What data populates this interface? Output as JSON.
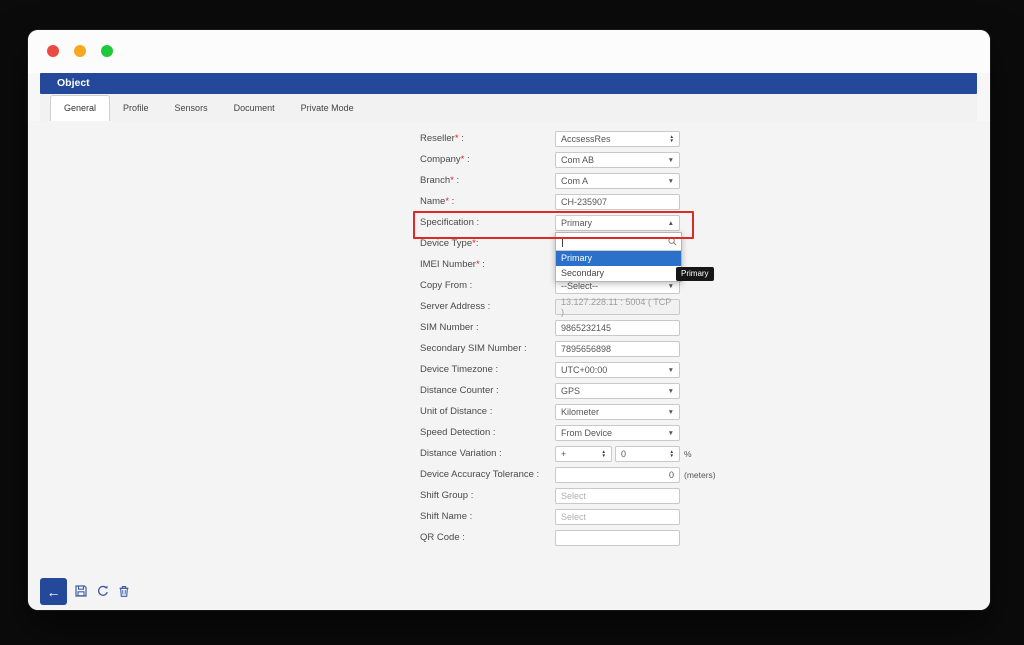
{
  "colors": {
    "header_blue": "#24489a",
    "selected_option_blue": "#2b71c9",
    "highlight_red": "#dc2a27",
    "traffic_red": "#e94b42",
    "traffic_yellow": "#f7a81d",
    "traffic_green": "#1fc93c",
    "icon_blue": "#3f5ca6"
  },
  "header": {
    "title": "Object"
  },
  "tabs": [
    {
      "label": "General",
      "active": true
    },
    {
      "label": "Profile",
      "active": false
    },
    {
      "label": "Sensors",
      "active": false
    },
    {
      "label": "Document",
      "active": false
    },
    {
      "label": "Private Mode",
      "active": false
    }
  ],
  "form": {
    "rows": [
      {
        "label": "Reseller",
        "req": "*",
        "sep": " :",
        "value": "AccsessRes"
      },
      {
        "label": "Company",
        "req": "*",
        "sep": " :",
        "value": "Com AB"
      },
      {
        "label": "Branch",
        "req": "*",
        "sep": " :",
        "value": "Com A"
      },
      {
        "label": "Name",
        "req": "*",
        "sep": " :",
        "value": "CH-235907"
      },
      {
        "label": "Specification",
        "req": "",
        "sep": " :",
        "value": "Primary"
      },
      {
        "label": "Device Type",
        "req": "*",
        "sep": ":",
        "value": ""
      },
      {
        "label": "IMEI Number",
        "req": "*",
        "sep": " :",
        "value": ""
      },
      {
        "label": "Copy From",
        "req": "",
        "sep": " :",
        "value": "--Select--"
      },
      {
        "label": "Server Address",
        "req": "",
        "sep": " :",
        "value": "13.127.228.11 : 5004 ( TCP )"
      },
      {
        "label": "SIM Number",
        "req": "",
        "sep": " :",
        "value": "9865232145"
      },
      {
        "label": "Secondary SIM Number",
        "req": "",
        "sep": " :",
        "value": "7895656898"
      },
      {
        "label": "Device Timezone",
        "req": "",
        "sep": " :",
        "value": "UTC+00:00"
      },
      {
        "label": "Distance Counter",
        "req": "",
        "sep": " :",
        "value": "GPS"
      },
      {
        "label": "Unit of Distance",
        "req": "",
        "sep": " :",
        "value": "Kilometer"
      },
      {
        "label": "Speed Detection",
        "req": "",
        "sep": " :",
        "value": "From Device"
      },
      {
        "label": "Distance Variation",
        "req": "",
        "sep": " :",
        "value1": "+",
        "value2": "0",
        "suffix": "%"
      },
      {
        "label": "Device Accuracy Tolerance",
        "req": "",
        "sep": " :",
        "value": "0",
        "suffix": "(meters)"
      },
      {
        "label": "Shift Group",
        "req": "",
        "sep": " :",
        "value": "",
        "placeholder": "Select"
      },
      {
        "label": "Shift Name",
        "req": "",
        "sep": " :",
        "value": "",
        "placeholder": "Select"
      },
      {
        "label": "QR Code",
        "req": "",
        "sep": " :",
        "value": ""
      }
    ]
  },
  "dropdown": {
    "search_value": "",
    "options": [
      {
        "label": "Primary",
        "selected": true
      },
      {
        "label": "Secondary",
        "selected": false
      }
    ]
  },
  "tooltip": {
    "text": "Primary"
  },
  "toolbar": {
    "buttons": [
      "back",
      "save",
      "refresh",
      "delete"
    ]
  }
}
